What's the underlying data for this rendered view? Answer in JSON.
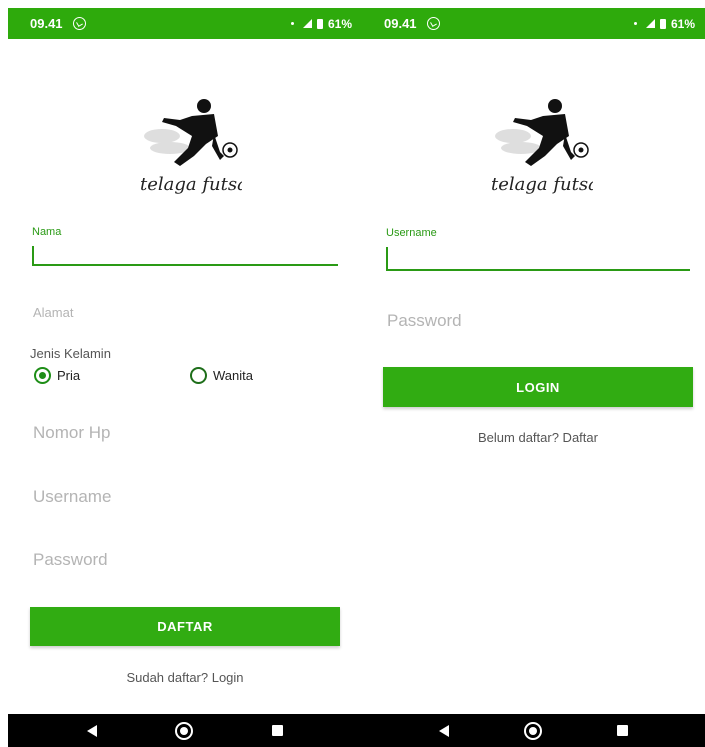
{
  "colors": {
    "primary": "#2eaa0c",
    "accent": "#2a9a15",
    "button": "#31ac12",
    "hint": "#b4b4b4"
  },
  "status_bar": {
    "time": "09.41",
    "battery": "61%"
  },
  "register_screen": {
    "logo_text": "telaga futsal",
    "name_label": "Nama",
    "address_hint": "Alamat",
    "gender_label": "Jenis Kelamin",
    "gender_options": [
      {
        "label": "Pria",
        "selected": true
      },
      {
        "label": "Wanita",
        "selected": false
      }
    ],
    "phone_hint": "Nomor Hp",
    "username_hint": "Username",
    "password_hint": "Password",
    "submit_label": "DAFTAR",
    "footer_link": "Sudah daftar? Login"
  },
  "login_screen": {
    "logo_text": "telaga futsal",
    "username_label": "Username",
    "password_hint": "Password",
    "submit_label": "LOGIN",
    "footer_link": "Belum daftar? Daftar"
  }
}
